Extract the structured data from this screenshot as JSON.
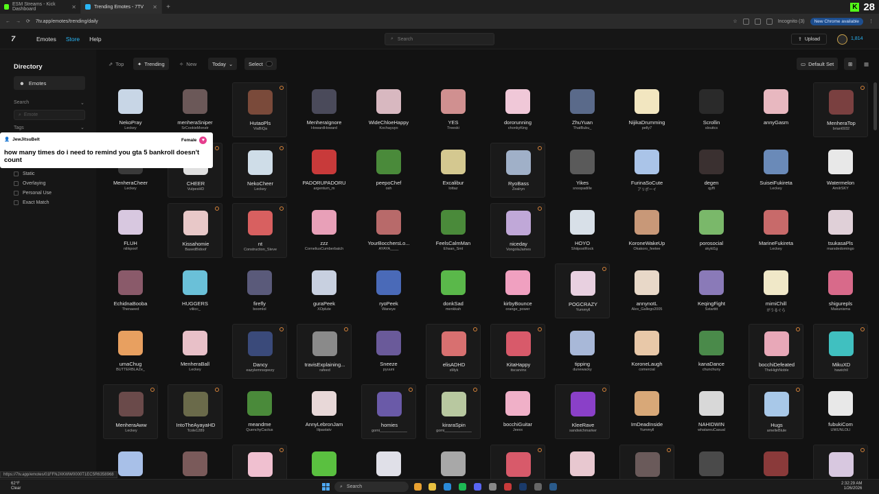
{
  "browser": {
    "tabs": [
      {
        "label": "ESM Streams - Kick Dashboard",
        "active": false,
        "color": "#53fc18"
      },
      {
        "label": "Trending Emotes - 7TV",
        "active": true,
        "color": "#29b6f6"
      }
    ],
    "url": "7tv.app/emotes/trending/daily",
    "incognito_label": "Incognito (3)",
    "new_chrome_label": "New Chrome available",
    "kick_count": "28"
  },
  "header": {
    "nav": {
      "emotes": "Emotes",
      "store": "Store",
      "help": "Help"
    },
    "search_placeholder": "Search",
    "upload_label": "Upload",
    "points": "1,814"
  },
  "sidebar": {
    "title": "Directory",
    "emotes_label": "Emotes",
    "search_label": "Search",
    "search_placeholder": "Emote",
    "tags_label": "Tags",
    "options": [
      "Static",
      "Overlaying",
      "Personal Use",
      "Exact Match"
    ]
  },
  "chat_popup": {
    "username": "JewJitsuBelt",
    "gender": "Female",
    "message": "how many times do i need to remind you gta 5 bankroll doesn't count"
  },
  "toolbar": {
    "top": "Top",
    "trending": "Trending",
    "new": "New",
    "period": "Today",
    "select": "Select",
    "default_set": "Default Set"
  },
  "emote_rows": [
    [
      {
        "name": "NekoPray",
        "owner": "Leckey",
        "color": "#c8d6e6",
        "boxed": false,
        "flag": false
      },
      {
        "name": "menheraSniper",
        "owner": "SrCookieMonstr",
        "color": "#6b5858",
        "boxed": false,
        "flag": false
      },
      {
        "name": "HutaoPls",
        "owner": "ViaBiQa",
        "color": "#7a4a3a",
        "boxed": true,
        "flag": true
      },
      {
        "name": "MenheraIgnore",
        "owner": "HowardHoward",
        "color": "#4a4a5a",
        "boxed": false,
        "flag": false
      },
      {
        "name": "WideChloeHappy",
        "owner": "Kochayuyo",
        "color": "#d8b8c0",
        "boxed": false,
        "flag": false
      },
      {
        "name": "YES",
        "owner": "Treeski",
        "color": "#d09090",
        "boxed": false,
        "flag": false
      },
      {
        "name": "dororunning",
        "owner": "chonkyKing",
        "color": "#f0c8d8",
        "boxed": false,
        "flag": false
      },
      {
        "name": "ZhuYuan",
        "owner": "ThatBubu_",
        "color": "#5a6a8a",
        "boxed": false,
        "flag": false
      },
      {
        "name": "NijikaDrumming",
        "owner": "pelly7",
        "color": "#f2e6c0",
        "boxed": false,
        "flag": false
      },
      {
        "name": "Scrollin",
        "owner": "slouitcs",
        "color": "#2a2a2a",
        "boxed": false,
        "flag": false
      },
      {
        "name": "annyGasm",
        "owner": "",
        "color": "#e8b8c0",
        "boxed": false,
        "flag": false
      },
      {
        "name": "MenheraTop",
        "owner": "brian6932",
        "color": "#7a4040",
        "boxed": true,
        "flag": true
      }
    ],
    [
      {
        "name": "MenheraCheer",
        "owner": "Leckey",
        "color": "#3a3a3a",
        "boxed": false,
        "flag": false
      },
      {
        "name": "CHEER",
        "owner": "VulpesHD",
        "color": "#e0e0e0",
        "boxed": true,
        "flag": true
      },
      {
        "name": "NekoCheer",
        "owner": "Leckey",
        "color": "#cfdde8",
        "boxed": true,
        "flag": true
      },
      {
        "name": "PADORUPADORU",
        "owner": "argentum_m",
        "color": "#c83a3a",
        "boxed": false,
        "flag": false
      },
      {
        "name": "peepoChef",
        "owner": "osh",
        "color": "#4a8a3a",
        "boxed": false,
        "flag": false
      },
      {
        "name": "Excalibur",
        "owner": "lottaz",
        "color": "#d4c890",
        "boxed": false,
        "flag": false
      },
      {
        "name": "RyoBass",
        "owner": "Zealryn",
        "color": "#a0b0c8",
        "boxed": true,
        "flag": true
      },
      {
        "name": "Yikes",
        "owner": "snoopadille",
        "color": "#5a5a5a",
        "boxed": false,
        "flag": false
      },
      {
        "name": "FurinaSoCute",
        "owner": "アリポーイ",
        "color": "#aac4e8",
        "boxed": false,
        "flag": false
      },
      {
        "name": "degen",
        "owner": "qyffi",
        "color": "#3a3030",
        "boxed": false,
        "flag": false
      },
      {
        "name": "SuiseiFukireta",
        "owner": "Leckey",
        "color": "#6a8ab8",
        "boxed": false,
        "flag": false
      },
      {
        "name": "Watermelon",
        "owner": "AmilrSKY",
        "color": "#e8e8e8",
        "boxed": false,
        "flag": false
      }
    ],
    [
      {
        "name": "FLUH",
        "owner": "nilikpoof",
        "color": "#d8c8e0",
        "boxed": false,
        "flag": false
      },
      {
        "name": "Kissahomie",
        "owner": "BasedBidoof",
        "color": "#e8c8c8",
        "boxed": true,
        "flag": true
      },
      {
        "name": "nt",
        "owner": "Construction_Steve",
        "color": "#d86060",
        "boxed": true,
        "flag": true
      },
      {
        "name": "zzz",
        "owner": "CorneliusCumberbatch",
        "color": "#e8a0b8",
        "boxed": false,
        "flag": false
      },
      {
        "name": "YourBocchersLo...",
        "owner": "AYAYA____",
        "color": "#b86a6a",
        "boxed": false,
        "flag": false
      },
      {
        "name": "FeelsCalmMan",
        "owner": "Ehsan_Sml",
        "color": "#4a8a3a",
        "boxed": false,
        "flag": false
      },
      {
        "name": "niceday",
        "owner": "VongolaJames",
        "color": "#c0a8d8",
        "boxed": true,
        "flag": true
      },
      {
        "name": "HOYO",
        "owner": "ShitpostRock",
        "color": "#d8e0e8",
        "boxed": false,
        "flag": false
      },
      {
        "name": "KoroneWakeUp",
        "owner": "Okakoro_feetee",
        "color": "#c89878",
        "boxed": false,
        "flag": false
      },
      {
        "name": "porosocial",
        "owner": "skyld1g",
        "color": "#7ab86a",
        "boxed": false,
        "flag": false
      },
      {
        "name": "MarineFukireta",
        "owner": "Leckey",
        "color": "#c86a6a",
        "boxed": false,
        "flag": false
      },
      {
        "name": "tsukasaPls",
        "owner": "marsdedomingo",
        "color": "#e0d0d8",
        "boxed": false,
        "flag": false
      }
    ],
    [
      {
        "name": "EchidnaBooba",
        "owner": "Thenaeed",
        "color": "#8a5a6a",
        "boxed": false,
        "flag": false
      },
      {
        "name": "HUGGERS",
        "owner": "viliicc_",
        "color": "#6ac0d8",
        "boxed": false,
        "flag": false
      },
      {
        "name": "firefly",
        "owner": "boomlol",
        "color": "#5a5a7a",
        "boxed": false,
        "flag": false
      },
      {
        "name": "guraPeek",
        "owner": "XOplute",
        "color": "#c8d0e0",
        "boxed": false,
        "flag": false
      },
      {
        "name": "ryoPeek",
        "owner": "Waneye",
        "color": "#4a6ab8",
        "boxed": false,
        "flag": false
      },
      {
        "name": "donkSad",
        "owner": "menkkah",
        "color": "#5ab84a",
        "boxed": false,
        "flag": false
      },
      {
        "name": "kirbyBounce",
        "owner": "orange_power",
        "color": "#f0a0c0",
        "boxed": false,
        "flag": false
      },
      {
        "name": "POGCRAZY",
        "owner": "Yummyll",
        "color": "#e8d0e0",
        "boxed": true,
        "flag": true
      },
      {
        "name": "annynotL",
        "owner": "Alex_Gallego2005",
        "color": "#e8d8c8",
        "boxed": false,
        "flag": false
      },
      {
        "name": "KeqingFight",
        "owner": "Sstartitt",
        "color": "#8a7ab8",
        "boxed": false,
        "flag": false
      },
      {
        "name": "mimiChill",
        "owner": "がうるぐら",
        "color": "#f0e8c8",
        "boxed": false,
        "flag": false
      },
      {
        "name": "shigurepls",
        "owner": "Makunisma",
        "color": "#d86a8a",
        "boxed": false,
        "flag": false
      }
    ],
    [
      {
        "name": "umaChug",
        "owner": "BUTTERBLAZe_",
        "color": "#e8a060",
        "boxed": false,
        "flag": false
      },
      {
        "name": "MenheraBall",
        "owner": "Leckey",
        "color": "#e8c0c8",
        "boxed": false,
        "flag": false
      },
      {
        "name": "Dancy",
        "owner": "eazylemnsqeezy",
        "color": "#3a4a7a",
        "boxed": true,
        "flag": true
      },
      {
        "name": "travisExplaining...",
        "owner": "rafeed",
        "color": "#8a8a8a",
        "boxed": true,
        "flag": true
      },
      {
        "name": "Sneeze",
        "owner": "pyuuni",
        "color": "#6a5a9a",
        "boxed": false,
        "flag": false
      },
      {
        "name": "elisADHD",
        "owner": "sMyk",
        "color": "#d87070",
        "boxed": true,
        "flag": true
      },
      {
        "name": "KitaHappy",
        "owner": "itscarvinx",
        "color": "#d85a6a",
        "boxed": true,
        "flag": true
      },
      {
        "name": "tipping",
        "owner": "dunewacky",
        "color": "#a8b8d8",
        "boxed": false,
        "flag": false
      },
      {
        "name": "KoroneLaugh",
        "owner": "comercial",
        "color": "#e8c8a8",
        "boxed": false,
        "flag": false
      },
      {
        "name": "kanaDance",
        "owner": "chunchuny",
        "color": "#4a8a4a",
        "boxed": false,
        "flag": false
      },
      {
        "name": "bocchiDefeated",
        "owner": "TheHighNoble",
        "color": "#e8a8b8",
        "boxed": true,
        "flag": true
      },
      {
        "name": "MikuXD",
        "owner": "hawichil",
        "color": "#40c0c0",
        "boxed": true,
        "flag": true
      }
    ],
    [
      {
        "name": "MenheraAww",
        "owner": "Leckey",
        "color": "#6a4a4a",
        "boxed": true,
        "flag": true
      },
      {
        "name": "IntoTheAyayaHD",
        "owner": "Tcole1289",
        "color": "#6a6a4a",
        "boxed": true,
        "flag": true
      },
      {
        "name": "meandme",
        "owner": "QuenchyCactus",
        "color": "#4a8a3a",
        "boxed": false,
        "flag": false
      },
      {
        "name": "AnnyLebronJam",
        "owner": "lilpastatv",
        "color": "#e8d8d8",
        "boxed": false,
        "flag": false
      },
      {
        "name": "homies",
        "owner": "gomi_____________",
        "color": "#6a5aa8",
        "boxed": true,
        "flag": true
      },
      {
        "name": "kiraraSpin",
        "owner": "gomi_____________",
        "color": "#b8c8a0",
        "boxed": true,
        "flag": true
      },
      {
        "name": "bocchiGuitar",
        "owner": "Jeexx",
        "color": "#f0b0c8",
        "boxed": false,
        "flag": false
      },
      {
        "name": "KleeRave",
        "owner": "sandwichmarker",
        "color": "#8a40c8",
        "boxed": true,
        "flag": true
      },
      {
        "name": "ImDeadInside",
        "owner": "Yummyll",
        "color": "#d8a878",
        "boxed": false,
        "flag": false
      },
      {
        "name": "NAHIDWIN",
        "owner": "whatareuCasual",
        "color": "#d8d8d8",
        "boxed": false,
        "flag": false
      },
      {
        "name": "Hugs",
        "owner": "amelleBlule",
        "color": "#a8c8e8",
        "boxed": true,
        "flag": true
      },
      {
        "name": "fubukiCom",
        "owner": "UWUNLOLI",
        "color": "#e8e8e8",
        "boxed": false,
        "flag": false
      }
    ],
    [
      {
        "name": "",
        "owner": "",
        "color": "#a8c0e8",
        "boxed": false,
        "flag": false
      },
      {
        "name": "",
        "owner": "",
        "color": "#7a5a5a",
        "boxed": false,
        "flag": false
      },
      {
        "name": "",
        "owner": "",
        "color": "#f0c0d0",
        "boxed": true,
        "flag": true
      },
      {
        "name": "",
        "owner": "",
        "color": "#5ac040",
        "boxed": false,
        "flag": false
      },
      {
        "name": "",
        "owner": "",
        "color": "#e0e0e8",
        "boxed": false,
        "flag": false
      },
      {
        "name": "",
        "owner": "",
        "color": "#a8a8a8",
        "boxed": false,
        "flag": false
      },
      {
        "name": "",
        "owner": "",
        "color": "#d85a6a",
        "boxed": true,
        "flag": true
      },
      {
        "name": "",
        "owner": "",
        "color": "#e8c8d0",
        "boxed": false,
        "flag": false
      },
      {
        "name": "",
        "owner": "",
        "color": "#6a5a5a",
        "boxed": true,
        "flag": true
      },
      {
        "name": "",
        "owner": "",
        "color": "#4a4a4a",
        "boxed": false,
        "flag": false
      },
      {
        "name": "",
        "owner": "",
        "color": "#8a3a3a",
        "boxed": false,
        "flag": false
      },
      {
        "name": "",
        "owner": "",
        "color": "#d8c8e0",
        "boxed": true,
        "flag": true
      }
    ]
  ],
  "status_url": "https://7tv.app/emotes/01FFNJXKWW0000T1EC5R6358968",
  "taskbar": {
    "weather_temp": "62°F",
    "weather_desc": "Clear",
    "search_label": "Search",
    "time": "2:32:29 AM",
    "date": "1/26/2026"
  }
}
